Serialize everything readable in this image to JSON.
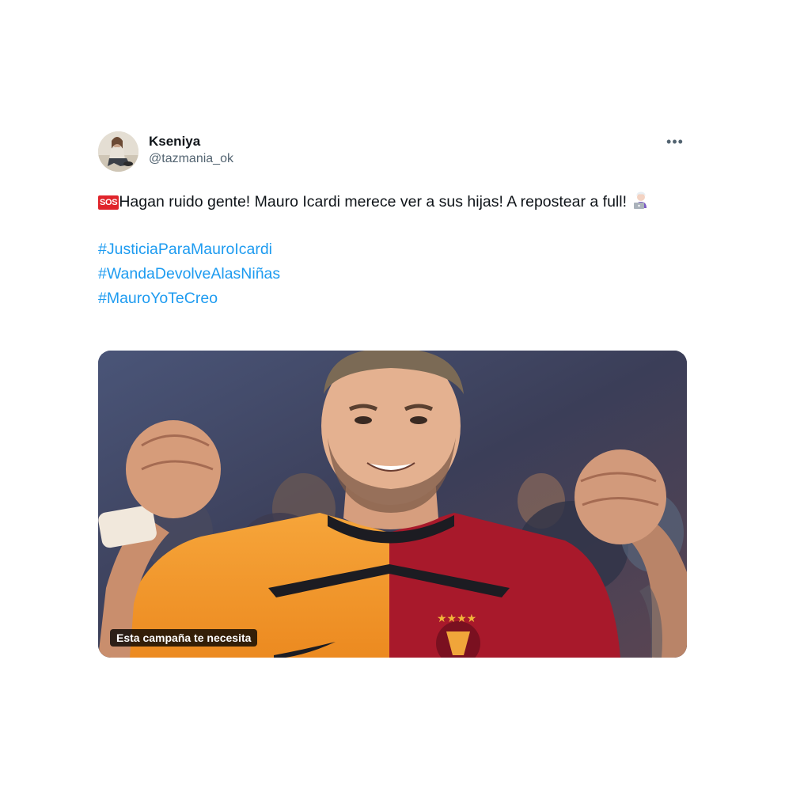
{
  "tweet": {
    "author": {
      "display_name": "Kseniya",
      "handle": "@tazmania_ok",
      "avatar_icon": "profile-avatar"
    },
    "more_label": "•••",
    "sos_label": "SOS",
    "text": "Hagan ruido gente! Mauro Icardi merece ver a sus hijas! A repostear a full!",
    "emoji_icon": "woman-technologist-icon",
    "hashtags": [
      "#JusticiaParaMauroIcardi",
      "#WandaDevolveAlasNiñas",
      "#MauroYoTeCreo"
    ],
    "media": {
      "caption": "Esta campaña te necesita"
    }
  },
  "colors": {
    "link": "#1d9bf0",
    "text": "#0f1419",
    "muted": "#536471",
    "sos": "#e0242b"
  }
}
